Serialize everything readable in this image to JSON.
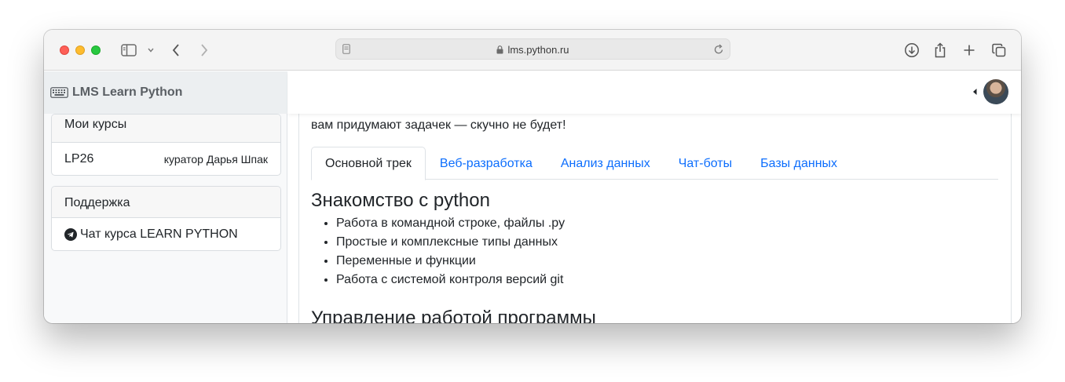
{
  "browser": {
    "url": "lms.python.ru"
  },
  "sidebar": {
    "brand": "LMS Learn Python",
    "courses_card": {
      "header": "Мои курсы",
      "course_name": "LP26",
      "curator": "куратор Дарья Шпак"
    },
    "support_card": {
      "header": "Поддержка",
      "chat_link": "Чат курса LEARN PYTHON"
    }
  },
  "main": {
    "intro": "вам придумают задачек — скучно не будет!",
    "tabs": [
      {
        "label": "Основной трек",
        "active": true
      },
      {
        "label": "Веб-разработка",
        "active": false
      },
      {
        "label": "Анализ данных",
        "active": false
      },
      {
        "label": "Чат-боты",
        "active": false
      },
      {
        "label": "Базы данных",
        "active": false
      }
    ],
    "sections": [
      {
        "title": "Знакомство с python",
        "items": [
          "Работа в командной строке, файлы .py",
          "Простые и комплексные типы данных",
          "Переменные и функции",
          "Работа с системой контроля версий git"
        ]
      },
      {
        "title": "Управление работой программы"
      }
    ]
  },
  "colors": {
    "link": "#0d6efd",
    "text": "#212529"
  }
}
